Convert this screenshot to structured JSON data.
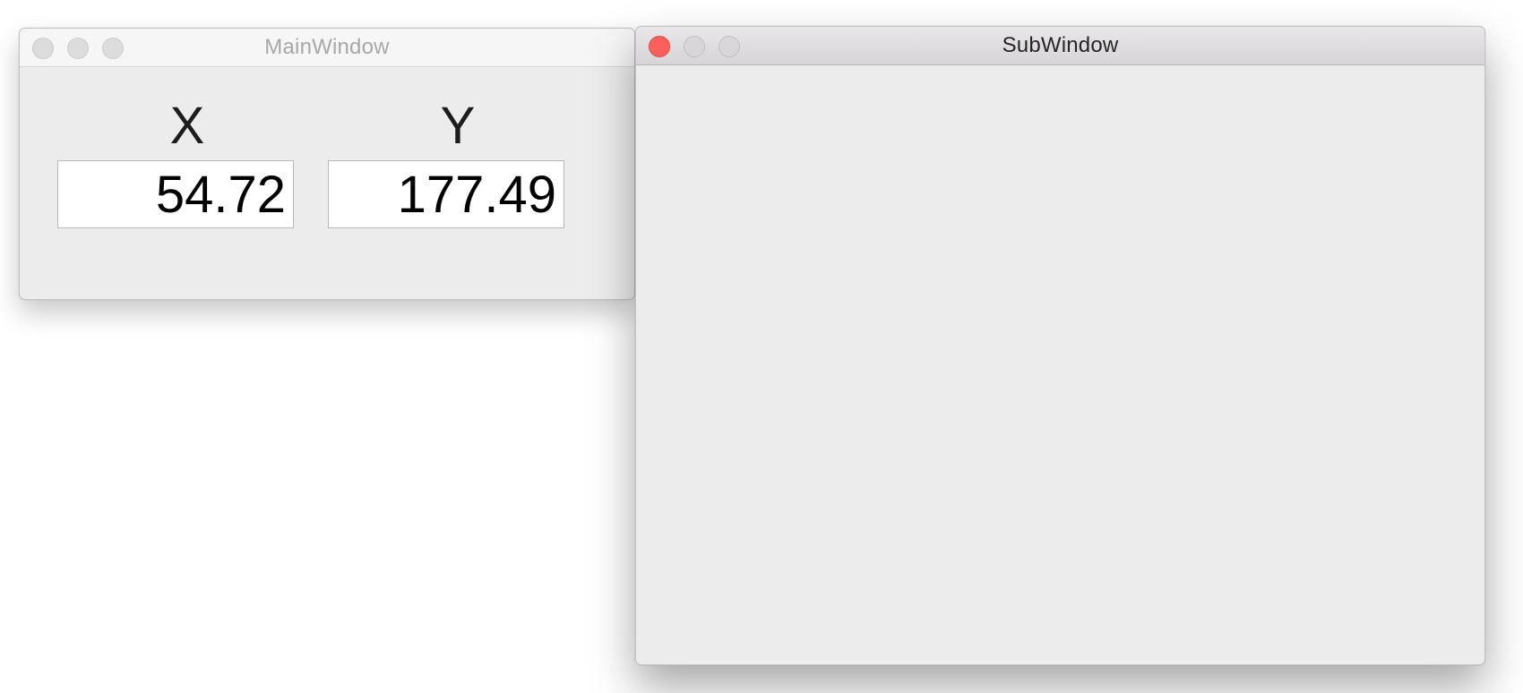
{
  "main_window": {
    "title": "MainWindow",
    "x_label": "X",
    "y_label": "Y",
    "x_value": "54.72",
    "y_value": "177.49"
  },
  "sub_window": {
    "title": "SubWindow"
  },
  "colors": {
    "close_active": "#fc605c",
    "window_bg": "#ececec",
    "desktop_bg": "#ffffff"
  }
}
